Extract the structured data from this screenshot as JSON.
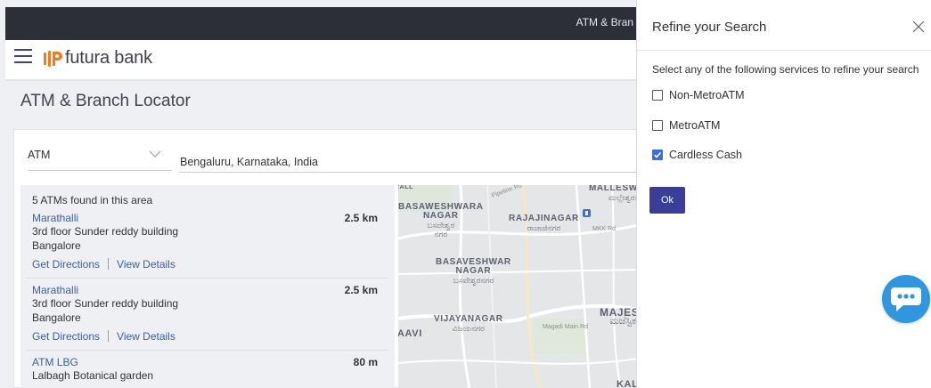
{
  "topbar": {
    "text": "ATM & Bran"
  },
  "header": {
    "brand": "futura bank"
  },
  "page": {
    "title": "ATM & Branch Locator"
  },
  "filter": {
    "type_value": "ATM",
    "location_value": "Bengaluru, Karnataka, India"
  },
  "results": {
    "found_text": "5 ATMs found in this area",
    "items": [
      {
        "name": "Marathalli",
        "address_line1": "3rd floor Sunder reddy building",
        "address_line2": "Bangalore",
        "distance": "2.5 km",
        "directions_label": "Get Directions",
        "details_label": "View Details"
      },
      {
        "name": "Marathalli",
        "address_line1": "3rd floor Sunder reddy building",
        "address_line2": "Bangalore",
        "distance": "2.5 km",
        "directions_label": "Get Directions",
        "details_label": "View Details"
      },
      {
        "name": "ATM LBG",
        "address_line1": "Lalbagh Botanical garden",
        "address_line2": "",
        "distance": "80 m"
      }
    ]
  },
  "map": {
    "labels": {
      "malleswara": "MALLESWARA",
      "malleswara_kn": "ಮಲ್ಲೇಶ್ವರಂ",
      "basaweshwara": "BASAWESHWARA",
      "basaweshwara_nagar": "NAGAR",
      "basaweshwara_kn": "ಬಸವೇಶ್ವರ",
      "basaweshwara_kn2": "ನಗರ",
      "rajajinagar": "RAJAJINAGAR",
      "rajajinagar_kn": "ರಾಜಾಜಿನಗರ",
      "basaveshwar": "BASAVESHWAR",
      "basaveshwar_nagar": "NAGAR",
      "basaveshwar_kn": "ಬಸವೇಶ್ವರನಗರ",
      "vijayanagar": "VIJAYANAGAR",
      "vijayanagar_kn": "ವಿಜಯನಗರ",
      "majest": "MAJEST",
      "majest_kn": "ಮಜೆಸ್ಟಿಕ",
      "aavi": "AAVI",
      "kal": "KAL",
      "road1": "Pipeline Rd",
      "road2": "MKK Rd",
      "road3": "Magadi Main Rd"
    }
  },
  "refine": {
    "title": "Refine your Search",
    "description": "Select any of the following services to refine your search",
    "options": [
      {
        "label": "Non-MetroATM",
        "checked": false
      },
      {
        "label": "MetroATM",
        "checked": false
      },
      {
        "label": "Cardless Cash",
        "checked": true
      }
    ],
    "ok_label": "Ok"
  },
  "colors": {
    "brand": "#3b3e97",
    "link": "#3a5fa8",
    "checkbox": "#3a6fd8",
    "chat": "#2f97e0",
    "topbar": "#2d2f36"
  }
}
